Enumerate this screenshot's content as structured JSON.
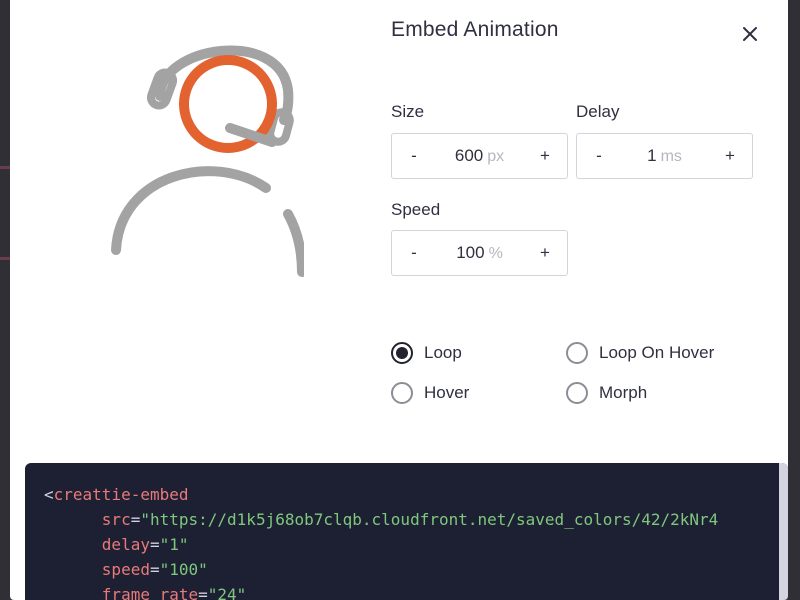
{
  "dialog": {
    "title": "Embed Animation",
    "close_icon": "close-icon"
  },
  "preview": {
    "icon": "headset-support-person-icon",
    "accent_color": "#e2632f",
    "stroke_color": "#a3a3a3"
  },
  "size": {
    "label": "Size",
    "minus": "-",
    "value": "600",
    "unit": "px",
    "plus": "+"
  },
  "delay": {
    "label": "Delay",
    "minus": "-",
    "value": "1",
    "unit": "ms",
    "plus": "+"
  },
  "speed": {
    "label": "Speed",
    "minus": "-",
    "value": "100",
    "unit": "%",
    "plus": "+"
  },
  "modes": {
    "loop": {
      "label": "Loop",
      "checked": true
    },
    "loop_on_hover": {
      "label": "Loop On Hover",
      "checked": false
    },
    "hover": {
      "label": "Hover",
      "checked": false
    },
    "morph": {
      "label": "Morph",
      "checked": false
    }
  },
  "code": {
    "open_tag": "<",
    "tag_name": "creattie-embed",
    "src_attr": "src",
    "src_value": "\"https://d1k5j68ob7clqb.cloudfront.net/saved_colors/42/2kNr4",
    "delay_attr": "delay",
    "delay_value": "\"1\"",
    "speed_attr": "speed",
    "speed_value": "\"100\"",
    "frame_attr": "frame_rate",
    "frame_value": "\"24\"",
    "equals": "="
  }
}
